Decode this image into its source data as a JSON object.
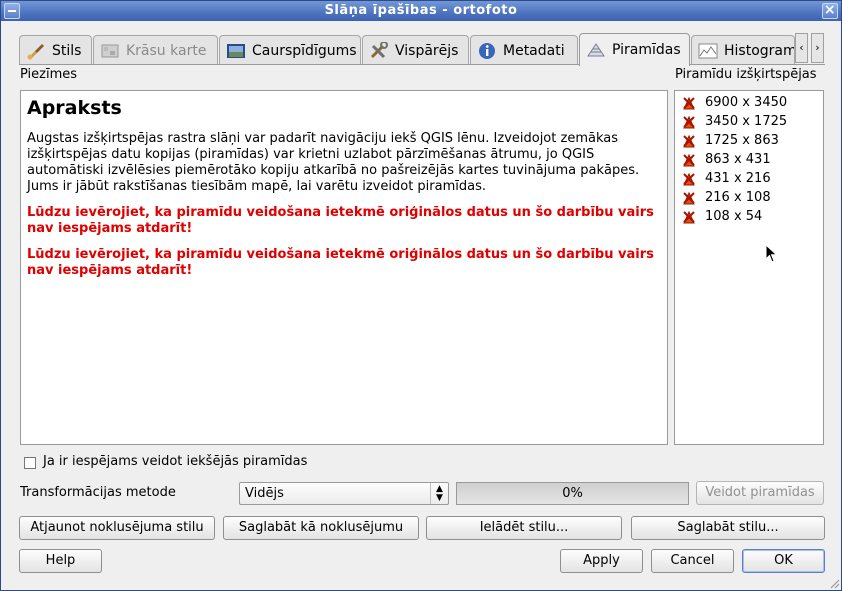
{
  "window": {
    "title": "Slāņa īpašības - ortofoto",
    "close_glyph": "×"
  },
  "tabs": [
    {
      "label": "Stils",
      "icon": "brush-icon"
    },
    {
      "label": "Krāsu karte",
      "icon": "colormap-icon",
      "disabled": true
    },
    {
      "label": "Caurspīdīgums",
      "icon": "transparency-icon"
    },
    {
      "label": "Vispārējs",
      "icon": "tools-icon"
    },
    {
      "label": "Metadati",
      "icon": "info-icon"
    },
    {
      "label": "Piramīdas",
      "icon": "pyramid-icon",
      "active": true
    },
    {
      "label": "Histogram",
      "icon": "histogram-icon"
    }
  ],
  "tab_scroll": {
    "left": "‹",
    "right": "›"
  },
  "notes": {
    "label": "Piezīmes",
    "heading": "Apraksts",
    "paragraph": "Augstas izšķirtspējas rastra slāņi var padarīt navigāciju iekš QGIS lēnu. Izveidojot zemākas izšķirtspējas datu kopijas (piramīdas) var krietni uzlabot pārzīmēšanas ātrumu, jo QGIS automātiski izvēlēsies piemērotāko kopiju atkarībā no pašreizējās kartes tuvinājuma pakāpes. Jums ir jābūt rakstīšanas tiesībām mapē, lai varētu izveidot piramīdas.",
    "warning_1": "Lūdzu ievērojiet, ka piramīdu veidošana ietekmē oriģinālos datus un šo darbību vairs nav iespējams atdarīt!",
    "warning_2": "Lūdzu ievērojiet, ka piramīdu veidošana ietekmē oriģinālos datus un šo darbību vairs nav iespējams atdarīt!",
    "warning_color": "#e00000"
  },
  "resolutions": {
    "label": "Piramīdu izšķirtspējas",
    "items": [
      "6900 x 3450",
      "3450 x 1725",
      "1725 x 863",
      "863 x 431",
      "431 x 216",
      "216 x 108",
      "108 x 54"
    ]
  },
  "internal_pyramids": {
    "label": "Ja ir iespējams veidot iekšējās piramīdas",
    "checked": false
  },
  "transform": {
    "label": "Transformācijas metode",
    "selected": "Vidējs"
  },
  "progress": {
    "value": 0,
    "text": "0%"
  },
  "buttons": {
    "build": "Veidot piramīdas",
    "restore_default": "Atjaunot noklusējuma stilu",
    "save_default": "Saglabāt kā noklusējumu",
    "load_style": "Ielādēt stilu...",
    "save_style": "Saglabāt stilu...",
    "help": "Help",
    "apply": "Apply",
    "cancel": "Cancel",
    "ok": "OK"
  },
  "colors": {
    "titlebar": "#4d73c0",
    "window_bg": "#efefef",
    "progress_fill": "#6f91d6"
  }
}
